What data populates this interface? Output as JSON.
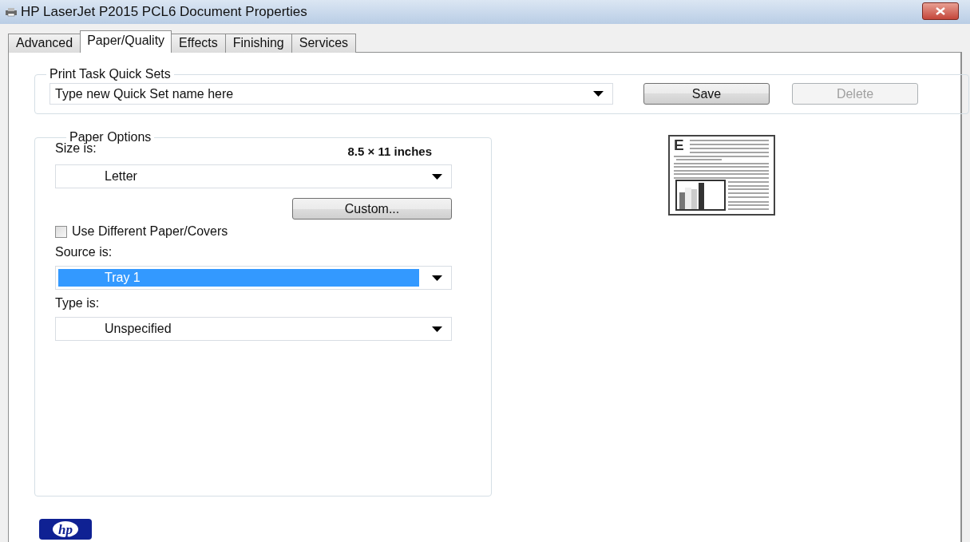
{
  "window": {
    "title": "HP LaserJet P2015 PCL6 Document Properties"
  },
  "tabs": [
    {
      "label": "Advanced",
      "selected": false
    },
    {
      "label": "Paper/Quality",
      "selected": true
    },
    {
      "label": "Effects",
      "selected": false
    },
    {
      "label": "Finishing",
      "selected": false
    },
    {
      "label": "Services",
      "selected": false
    }
  ],
  "quick_sets": {
    "legend": "Print Task Quick Sets",
    "combo": {
      "value": "Type new Quick Set name here",
      "highlighted": false
    },
    "buttons": [
      {
        "label": "Save",
        "disabled": false
      },
      {
        "label": "Delete",
        "disabled": true
      }
    ]
  },
  "paper_options": {
    "legend": "Paper Options",
    "size_label": "Size is:",
    "size_dimensions": "8.5 × 11 inches",
    "size_combo": {
      "value": "Letter",
      "highlighted": false
    },
    "custom_button": "Custom...",
    "different_paper": {
      "label": "Use Different Paper/Covers",
      "checked": false
    },
    "source_label": "Source is:",
    "source_combo": {
      "value": "Tray 1",
      "highlighted": true
    },
    "type_label": "Type is:",
    "type_combo": {
      "value": "Unspecified",
      "highlighted": false
    }
  },
  "preview": {
    "letter": "E"
  },
  "logo": {
    "text": "hp"
  }
}
